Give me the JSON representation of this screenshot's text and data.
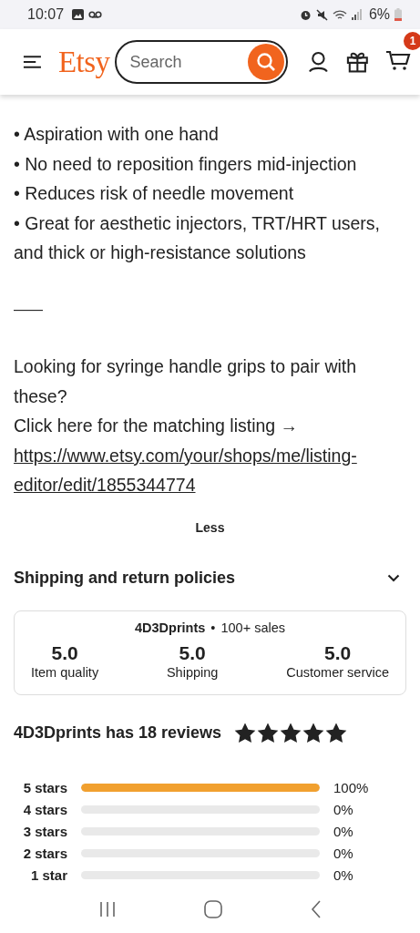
{
  "status_bar": {
    "time": "10:07",
    "battery": "6%"
  },
  "header": {
    "logo": "Etsy",
    "search": {
      "placeholder": "Search"
    },
    "cart_count": "1"
  },
  "bullets": [
    "• Aspiration with one hand",
    "• No need to reposition fingers mid-injection",
    "• Reduces risk of needle movement",
    "• Great for aesthetic injectors, TRT/HRT users, and thick or high-resistance solutions"
  ],
  "separator": "——",
  "paragraph": {
    "question": "Looking for syringe handle grips to pair with these?",
    "link_intro": "Click here for the matching listing →",
    "link": "https://www.etsy.com/your/shops/me/listing-editor/edit/1855344774"
  },
  "less_button": "Less",
  "shipping_section": {
    "title": "Shipping and return policies",
    "expanded": false
  },
  "shop_card": {
    "shop": "4D3Dprints",
    "bullet": "•",
    "sales": "100+ sales",
    "ratings": [
      {
        "score": "5.0",
        "label": "Item quality"
      },
      {
        "score": "5.0",
        "label": "Shipping"
      },
      {
        "score": "5.0",
        "label": "Customer service"
      }
    ]
  },
  "reviews": {
    "title": "4D3Dprints has 18 reviews",
    "stars": 5,
    "breakdown": [
      {
        "label": "5 stars",
        "level": 1,
        "percent": "100%"
      },
      {
        "label": "4 stars",
        "level": 0,
        "percent": "0%"
      },
      {
        "label": "3 stars",
        "level": 0,
        "percent": "0%"
      },
      {
        "label": "2 stars",
        "level": 0,
        "percent": "0%"
      },
      {
        "label": "1 star",
        "level": 0,
        "percent": "0%"
      }
    ]
  }
}
